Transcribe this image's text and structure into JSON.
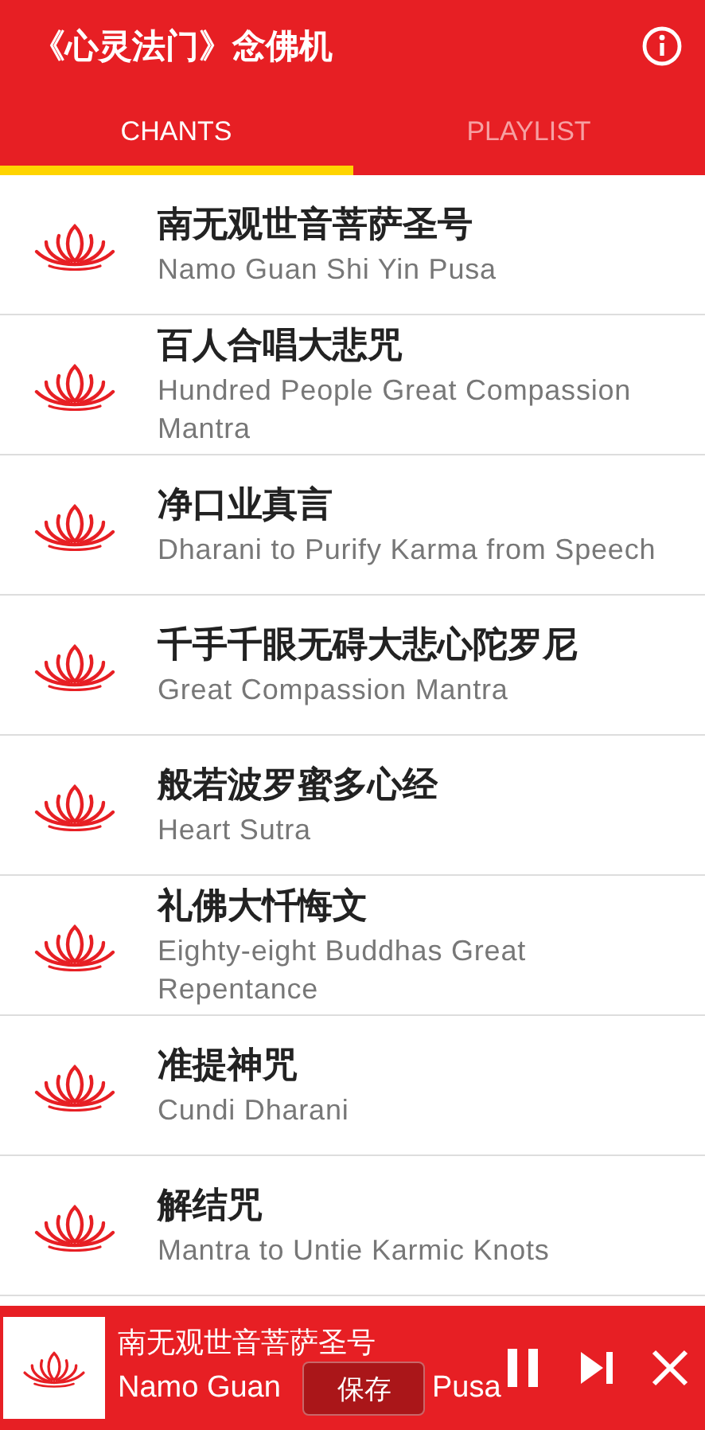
{
  "app_bar": {
    "title": "《心灵法门》念佛机"
  },
  "tabs": [
    {
      "label": "CHANTS",
      "selected": true
    },
    {
      "label": "PLAYLIST",
      "selected": false
    }
  ],
  "chants": [
    {
      "title": "南无观世音菩萨圣号",
      "subtitle": "Namo Guan Shi Yin Pusa"
    },
    {
      "title": "百人合唱大悲咒",
      "subtitle": "Hundred People Great Compassion Mantra"
    },
    {
      "title": "净口业真言",
      "subtitle": "Dharani to Purify Karma from Speech"
    },
    {
      "title": "千手千眼无碍大悲心陀罗尼",
      "subtitle": "Great Compassion Mantra"
    },
    {
      "title": "般若波罗蜜多心经",
      "subtitle": "Heart Sutra"
    },
    {
      "title": "礼佛大忏悔文",
      "subtitle": "Eighty-eight Buddhas Great Repentance"
    },
    {
      "title": "准提神咒",
      "subtitle": "Cundi Dharani"
    },
    {
      "title": "解结咒",
      "subtitle": "Mantra to Untie Karmic Knots"
    }
  ],
  "player": {
    "title": "南无观世音菩萨圣号",
    "subtitle_start": "Namo Guan",
    "subtitle_end": "Pusa",
    "playing": true
  },
  "save_popup": {
    "label": "保存"
  }
}
